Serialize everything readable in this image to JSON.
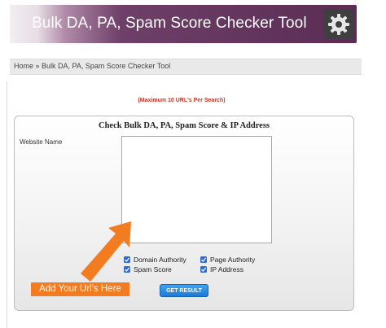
{
  "header": {
    "title": "Bulk DA, PA, Spam Score Checker Tool",
    "icon": "gear-icon"
  },
  "breadcrumb": {
    "text": "Home » Bulk DA, PA, Spam Score Checker Tool"
  },
  "notice": "(Maximum 10 URL's Per Search)",
  "form": {
    "title": "Check Bulk DA, PA, Spam Score & IP Address",
    "website_label": "Website Name",
    "textarea_value": "",
    "options": [
      {
        "label": "Domain Authority",
        "checked": true
      },
      {
        "label": "Page Authority",
        "checked": true
      },
      {
        "label": "Spam Score",
        "checked": true
      },
      {
        "label": "IP Address",
        "checked": true
      }
    ],
    "submit_label": "GET RESULT"
  },
  "annotation": {
    "label": "Add Your Url's Here",
    "color": "#f47c20"
  },
  "colors": {
    "header_purple": "#5a2d55",
    "checkbox_blue": "#2f6ad8",
    "button_blue": "#1c79d6",
    "notice_red": "#c0392b"
  }
}
